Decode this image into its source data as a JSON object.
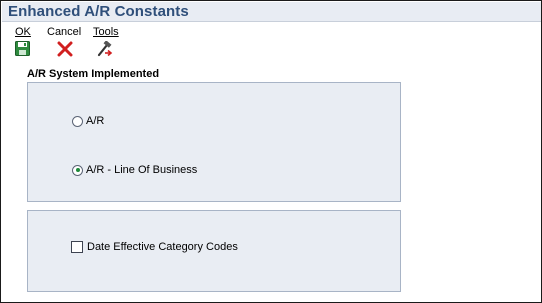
{
  "window": {
    "title": "Enhanced A/R Constants"
  },
  "toolbar": {
    "ok_label": "OK",
    "cancel_label": "Cancel",
    "tools_label": "Tools"
  },
  "section": {
    "title": "A/R System Implemented"
  },
  "radio_options": [
    {
      "label": "A/R",
      "selected": false
    },
    {
      "label": "A/R - Line Of Business",
      "selected": true
    }
  ],
  "checkbox": {
    "label": "Date Effective Category Codes",
    "checked": false
  },
  "icons": {
    "ok": "save-disk-icon",
    "cancel": "red-x-icon",
    "tools": "tools-hammer-icon"
  },
  "colors": {
    "title": "#2f4f7a",
    "panel_bg": "#e9edf3",
    "panel_border": "#a8b4c6",
    "cancel_red": "#d11f1f",
    "save_green": "#2e8b3e",
    "radio_selected": "#1e8a3a"
  }
}
